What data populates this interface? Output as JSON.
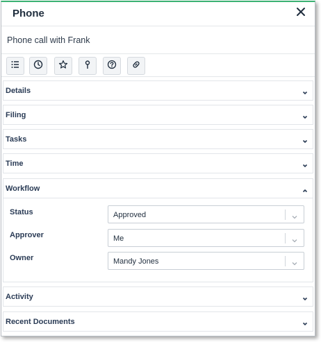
{
  "dialog": {
    "title": "Phone",
    "subtitle": "Phone call with Frank"
  },
  "toolbar": {
    "buttons": [
      {
        "icon": "list-icon"
      },
      {
        "icon": "clock-icon"
      },
      {
        "icon": "star-icon"
      },
      {
        "icon": "pin-icon"
      },
      {
        "icon": "help-icon"
      },
      {
        "icon": "link-icon"
      }
    ]
  },
  "sections": {
    "details": "Details",
    "filing": "Filing",
    "tasks": "Tasks",
    "time": "Time",
    "workflow": "Workflow",
    "activity": "Activity",
    "recent_documents": "Recent Documents"
  },
  "workflow": {
    "status_label": "Status",
    "status_value": "Approved",
    "approver_label": "Approver",
    "approver_value": "Me",
    "owner_label": "Owner",
    "owner_value": "Mandy Jones"
  },
  "colors": {
    "accent": "#3bb273",
    "heading": "#2a3b55",
    "border": "#e2e5e9"
  }
}
